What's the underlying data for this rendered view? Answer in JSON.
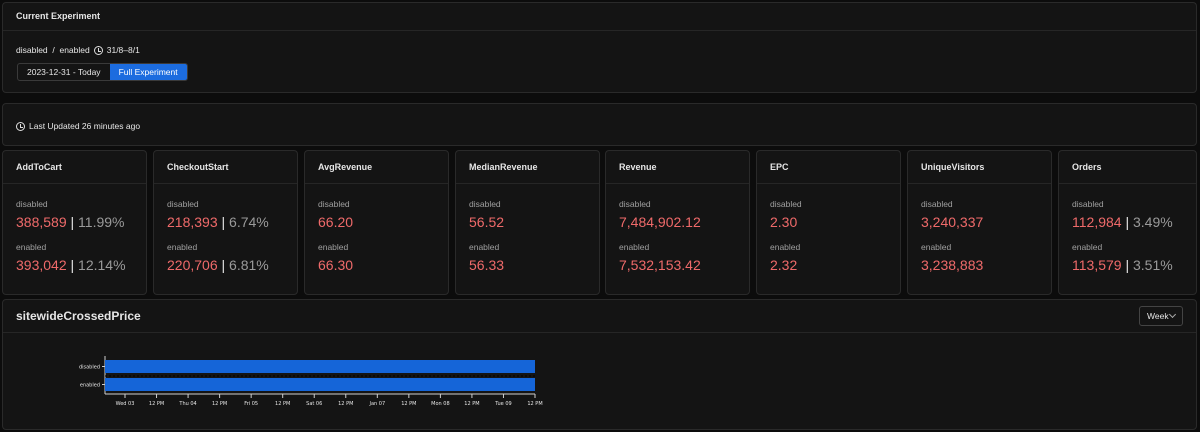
{
  "experiment": {
    "title": "Current Experiment",
    "variants_text": "disabled  /  enabled",
    "date_range": "31/8–8/1",
    "range_buttons": [
      {
        "label": "2023-12-31 - Today",
        "active": false
      },
      {
        "label": "Full Experiment",
        "active": true
      }
    ]
  },
  "last_updated": "Last Updated 26 minutes ago",
  "metrics": [
    {
      "name": "AddToCart",
      "disabled": {
        "label": "disabled",
        "value": "388,589",
        "pct": "11.99%"
      },
      "enabled": {
        "label": "enabled",
        "value": "393,042",
        "pct": "12.14%"
      }
    },
    {
      "name": "CheckoutStart",
      "disabled": {
        "label": "disabled",
        "value": "218,393",
        "pct": "6.74%"
      },
      "enabled": {
        "label": "enabled",
        "value": "220,706",
        "pct": "6.81%"
      }
    },
    {
      "name": "AvgRevenue",
      "disabled": {
        "label": "disabled",
        "value": "66.20",
        "pct": ""
      },
      "enabled": {
        "label": "enabled",
        "value": "66.30",
        "pct": ""
      }
    },
    {
      "name": "MedianRevenue",
      "disabled": {
        "label": "disabled",
        "value": "56.52",
        "pct": ""
      },
      "enabled": {
        "label": "enabled",
        "value": "56.33",
        "pct": ""
      }
    },
    {
      "name": "Revenue",
      "disabled": {
        "label": "disabled",
        "value": "7,484,902.12",
        "pct": ""
      },
      "enabled": {
        "label": "enabled",
        "value": "7,532,153.42",
        "pct": ""
      }
    },
    {
      "name": "EPC",
      "disabled": {
        "label": "disabled",
        "value": "2.30",
        "pct": ""
      },
      "enabled": {
        "label": "enabled",
        "value": "2.32",
        "pct": ""
      }
    },
    {
      "name": "UniqueVisitors",
      "disabled": {
        "label": "disabled",
        "value": "3,240,337",
        "pct": ""
      },
      "enabled": {
        "label": "enabled",
        "value": "3,238,883",
        "pct": ""
      }
    },
    {
      "name": "Orders",
      "disabled": {
        "label": "disabled",
        "value": "112,984",
        "pct": "3.49%"
      },
      "enabled": {
        "label": "enabled",
        "value": "113,579",
        "pct": "3.51%"
      }
    }
  ],
  "colors": {
    "accent": "#1c6cdf",
    "value_red": "#ef6a6a",
    "bar": "#1565d8"
  },
  "chart": {
    "title": "sitewideCrossedPrice",
    "granularity": "Week",
    "icon": "chevron-down-icon"
  },
  "chart_data": {
    "type": "bar",
    "orientation": "horizontal",
    "categories": [
      "disabled",
      "enabled"
    ],
    "x_ticks": [
      "Wed 03",
      "12 PM",
      "Thu 04",
      "12 PM",
      "Fri 05",
      "12 PM",
      "Sat 06",
      "12 PM",
      "Jan 07",
      "12 PM",
      "Mon 08",
      "12 PM",
      "Tue 09",
      "12 PM"
    ],
    "bars": [
      {
        "category": "disabled",
        "start": "Wed 03",
        "end": "12 PM (Tue 09)"
      },
      {
        "category": "enabled",
        "start": "Wed 03",
        "end": "12 PM (Tue 09)"
      }
    ]
  }
}
